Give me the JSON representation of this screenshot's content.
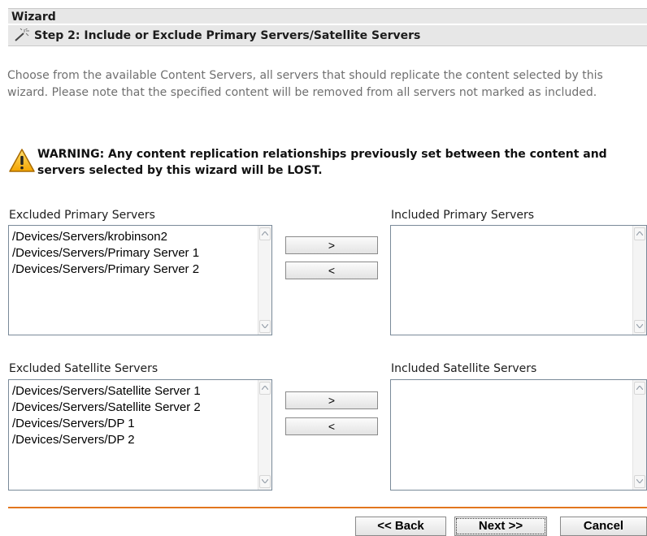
{
  "header": {
    "wizard_title": "Wizard",
    "step_title": "Step 2: Include or Exclude Primary Servers/Satellite Servers",
    "step_icon": "wizard-wand-icon"
  },
  "intro": {
    "text": "Choose from the available Content Servers, all servers that should replicate the content selected by this wizard. Please note that the specified content will be removed from all servers not marked as included."
  },
  "warning": {
    "icon": "warning-triangle-icon",
    "text": "WARNING: Any content replication relationships previously set between the content and servers selected by this wizard will be LOST."
  },
  "primary": {
    "excluded_label": "Excluded Primary Servers",
    "included_label": "Included Primary Servers",
    "excluded_items": [
      "/Devices/Servers/krobinson2",
      "/Devices/Servers/Primary Server 1",
      "/Devices/Servers/Primary Server 2"
    ],
    "included_items": [],
    "add_label": ">",
    "remove_label": "<"
  },
  "satellite": {
    "excluded_label": "Excluded Satellite Servers",
    "included_label": "Included Satellite Servers",
    "excluded_items": [
      "/Devices/Servers/Satellite Server 1",
      "/Devices/Servers/Satellite Server 2",
      "/Devices/Servers/DP 1",
      "/Devices/Servers/DP 2"
    ],
    "included_items": [],
    "add_label": ">",
    "remove_label": "<"
  },
  "footer": {
    "back_label": "<< Back",
    "next_label": "Next >>",
    "cancel_label": "Cancel",
    "accent_color": "#e2761e"
  }
}
